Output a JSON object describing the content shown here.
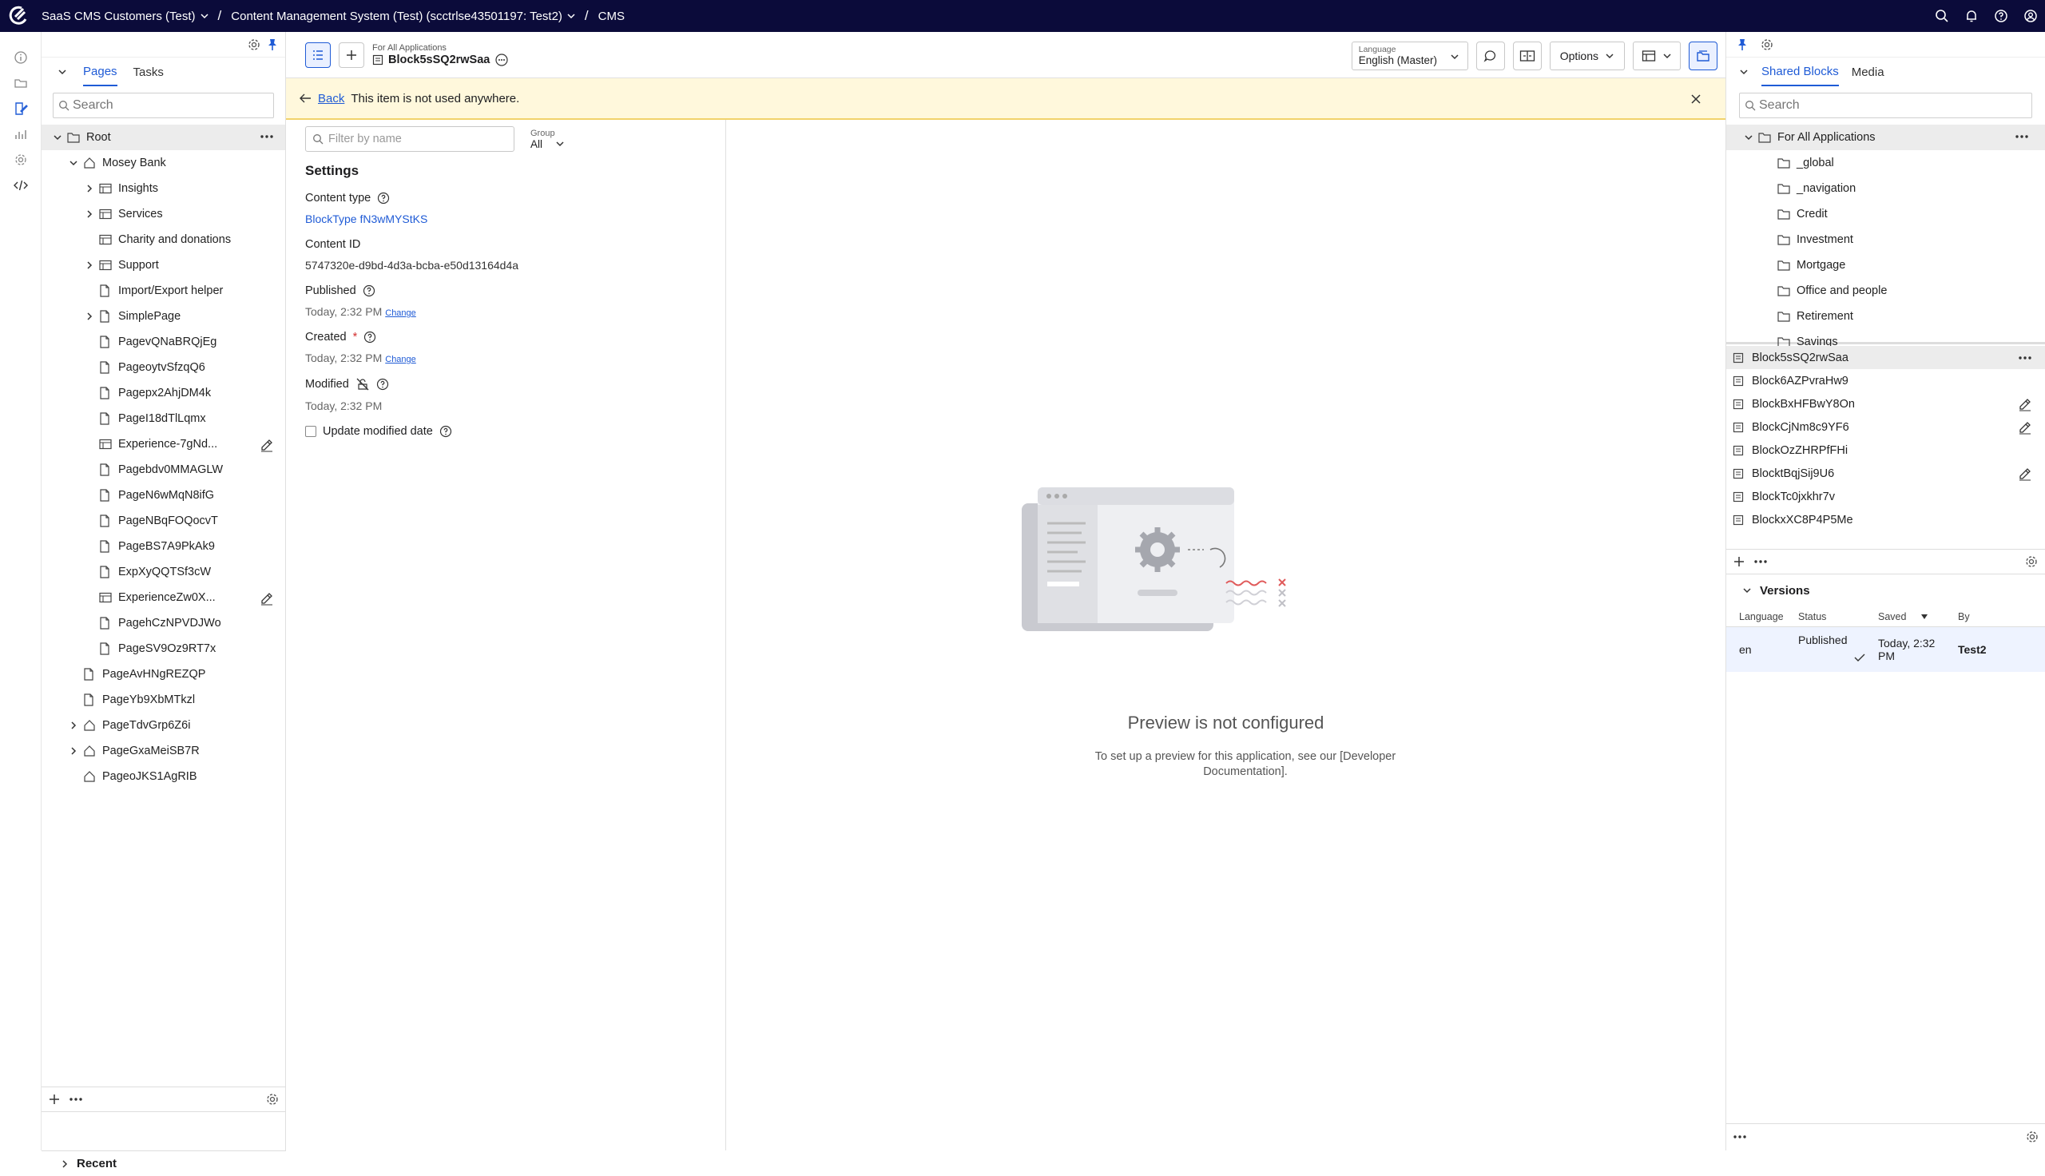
{
  "topbar": {
    "crumbs": [
      {
        "label": "SaaS CMS Customers (Test)"
      },
      {
        "label": "Content Management System (Test) (scctrlse43501197: Test2)"
      },
      {
        "label": "CMS"
      }
    ]
  },
  "pages_panel": {
    "tabs": [
      "Pages",
      "Tasks"
    ],
    "search_placeholder": "Search",
    "tree": [
      {
        "label": "Root",
        "depth": 0,
        "chevron": "down",
        "icon": "folder-icon",
        "selected": true,
        "action": "more"
      },
      {
        "label": "Mosey Bank",
        "depth": 1,
        "chevron": "down",
        "icon": "home-icon"
      },
      {
        "label": "Insights",
        "depth": 2,
        "chevron": "right",
        "icon": "table-icon"
      },
      {
        "label": "Services",
        "depth": 2,
        "chevron": "right",
        "icon": "table-icon"
      },
      {
        "label": "Charity and donations",
        "depth": 2,
        "chevron": "",
        "icon": "table-icon"
      },
      {
        "label": "Support",
        "depth": 2,
        "chevron": "right",
        "icon": "table-icon"
      },
      {
        "label": "Import/Export helper",
        "depth": 2,
        "chevron": "",
        "icon": "page-icon"
      },
      {
        "label": "SimplePage",
        "depth": 2,
        "chevron": "right",
        "icon": "page-icon"
      },
      {
        "label": "PagevQNaBRQjEg",
        "depth": 2,
        "chevron": "",
        "icon": "page-icon"
      },
      {
        "label": "PageoytvSfzqQ6",
        "depth": 2,
        "chevron": "",
        "icon": "page-icon"
      },
      {
        "label": "Pagepx2AhjDM4k",
        "depth": 2,
        "chevron": "",
        "icon": "page-icon"
      },
      {
        "label": "PageI18dTlLqmx",
        "depth": 2,
        "chevron": "",
        "icon": "page-icon"
      },
      {
        "label": "Experience-7gNd...",
        "depth": 2,
        "chevron": "",
        "icon": "table-icon",
        "action": "edit"
      },
      {
        "label": "Pagebdv0MMAGLW",
        "depth": 2,
        "chevron": "",
        "icon": "page-icon"
      },
      {
        "label": "PageN6wMqN8ifG",
        "depth": 2,
        "chevron": "",
        "icon": "page-icon"
      },
      {
        "label": "PageNBqFOQocvT",
        "depth": 2,
        "chevron": "",
        "icon": "page-icon"
      },
      {
        "label": "PageBS7A9PkAk9",
        "depth": 2,
        "chevron": "",
        "icon": "page-icon"
      },
      {
        "label": "ExpXyQQTSf3cW",
        "depth": 2,
        "chevron": "",
        "icon": "page-icon"
      },
      {
        "label": "ExperienceZw0X...",
        "depth": 2,
        "chevron": "",
        "icon": "table-icon",
        "action": "edit"
      },
      {
        "label": "PagehCzNPVDJWo",
        "depth": 2,
        "chevron": "",
        "icon": "page-icon"
      },
      {
        "label": "PageSV9Oz9RT7x",
        "depth": 2,
        "chevron": "",
        "icon": "page-icon"
      },
      {
        "label": "PageAvHNgREZQP",
        "depth": 1,
        "chevron": "",
        "icon": "page-icon"
      },
      {
        "label": "PageYb9XbMTkzl",
        "depth": 1,
        "chevron": "",
        "icon": "page-icon"
      },
      {
        "label": "PageTdvGrp6Z6i",
        "depth": 1,
        "chevron": "right",
        "icon": "home-icon"
      },
      {
        "label": "PageGxaMeiSB7R",
        "depth": 1,
        "chevron": "right",
        "icon": "home-icon"
      },
      {
        "label": "PageoJKS1AgRIB",
        "depth": 1,
        "chevron": "",
        "icon": "home-icon"
      }
    ],
    "recent_label": "Recent"
  },
  "editor": {
    "subtitle": "For All Applications",
    "title": "Block5sSQ2rwSaa",
    "language": {
      "label": "Language",
      "value": "English (Master)"
    },
    "options_label": "Options",
    "banner": {
      "back": "Back",
      "message": "This item is not used anywhere."
    },
    "filter_placeholder": "Filter by name",
    "group": {
      "label": "Group",
      "value": "All"
    },
    "settings_heading": "Settings",
    "fields": {
      "content_type": {
        "label": "Content type",
        "value": "BlockType fN3wMYStKS"
      },
      "content_id": {
        "label": "Content ID",
        "value": "5747320e-d9bd-4d3a-bcba-e50d13164d4a"
      },
      "published": {
        "label": "Published",
        "value": "Today, 2:32 PM",
        "change": "Change"
      },
      "created": {
        "label": "Created",
        "required": "*",
        "value": "Today, 2:32 PM",
        "change": "Change"
      },
      "modified": {
        "label": "Modified",
        "value": "Today, 2:32 PM"
      },
      "update_modified": {
        "label": "Update modified date"
      }
    },
    "preview": {
      "title": "Preview is not configured",
      "description": "To set up a preview for this application, see our [Developer Documentation]."
    }
  },
  "right_panel": {
    "tabs": [
      "Shared Blocks",
      "Media"
    ],
    "search_placeholder": "Search",
    "folders_root": "For All Applications",
    "folders": [
      "_global",
      "_navigation",
      "Credit",
      "Investment",
      "Mortgage",
      "Office and people",
      "Retirement",
      "Savings"
    ],
    "blocks": [
      {
        "label": "Block5sSQ2rwSaa",
        "selected": true,
        "action": "more"
      },
      {
        "label": "Block6AZPvraHw9"
      },
      {
        "label": "BlockBxHFBwY8On",
        "action": "edit"
      },
      {
        "label": "BlockCjNm8c9YF6",
        "action": "edit"
      },
      {
        "label": "BlockOzZHRPfFHi"
      },
      {
        "label": "BlocktBqjSij9U6",
        "action": "edit"
      },
      {
        "label": "BlockTc0jxkhr7v"
      },
      {
        "label": "BlockxXC8P4P5Me"
      }
    ],
    "versions": {
      "heading": "Versions",
      "columns": [
        "Language",
        "Status",
        "Saved",
        "By"
      ],
      "rows": [
        {
          "language": "en",
          "status": "Published",
          "saved": "Today, 2:32 PM",
          "by": "Test2"
        }
      ]
    }
  },
  "colors": {
    "topbar": "#0b0b3a",
    "accent": "#1f5bd6",
    "banner": "#fff8dc"
  }
}
